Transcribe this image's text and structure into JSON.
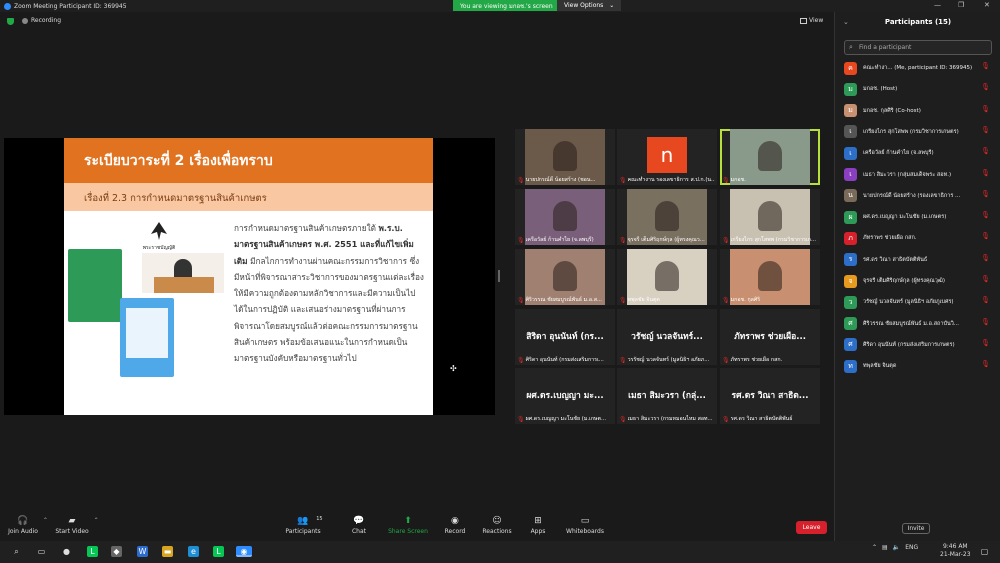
{
  "window": {
    "title": "Zoom Meeting Participant ID: 369945",
    "viewing_banner": "You are viewing มกอช.'s screen",
    "view_options": "View Options"
  },
  "meeting": {
    "recording": "Recording",
    "view": "View"
  },
  "slide": {
    "title": "ระเบียบวาระที่ 2   เรื่องเพื่อทราบ",
    "subtitle": "เรื่องที่ 2.3   การกำหนดมาตรฐานสินค้าเกษตร",
    "body_pre": "การกำหนดมาตรฐานสินค้าเกษตรภายใต้ ",
    "body_bold": "พ.ร.บ. มาตรฐานสินค้าเกษตร พ.ศ. 2551 และที่แก้ไขเพิ่มเติม",
    "body_post": " มีกลไกการทำงานผ่านคณะกรรมการวิชาการ ซึ่งมีหน้าที่พิจารณาสาระวิชาการของมาตรฐานแต่ละเรื่อง ให้มีความถูกต้องตามหลักวิชาการและมีความเป็นไปได้ในการปฏิบัติ และเสนอร่างมาตรฐานที่ผ่านการพิจารณาโดยสมบูรณ์แล้วต่อคณะกรรมการมาตรฐานสินค้าเกษตร พร้อมข้อเสนอแนะในการกำหนดเป็นมาตรฐานบังคับหรือมาตรฐานทั่วไป",
    "emblem_text": "พระราชบัญญัติ"
  },
  "tiles": [
    {
      "name": "นายปกรณ์ดิ์ น้อยสร้าง (ชอน...",
      "big": "",
      "kind": "video",
      "color": "#6b5a4a",
      "highlight": false
    },
    {
      "name": "คณะทำงาน รองเลขาธิการ ส.ป.ก.(น...",
      "big": "",
      "kind": "avatar",
      "avatar": "n",
      "highlight": false
    },
    {
      "name": "มกอช.",
      "big": "",
      "kind": "video",
      "color": "#8a9a8a",
      "highlight": true
    },
    {
      "name": "เครือวัลย์ ก้านคำไย (จ.ลพบุรี)",
      "big": "",
      "kind": "video",
      "color": "#7a5f7a",
      "highlight": false
    },
    {
      "name": "จุรจรี เต็มศิริฤกษ์กุล (ผู้ทรงคุณว...",
      "big": "",
      "kind": "video",
      "color": "#7a7060",
      "highlight": false
    },
    {
      "name": "เกรียงไกร สุกโสพพ (กรมวิชาการเก...",
      "big": "",
      "kind": "video",
      "color": "#c8c0b0",
      "highlight": false
    },
    {
      "name": "ศิริวรรณ ชัยสมบูรณ์พันธ์ ม.อ.ส...",
      "big": "",
      "kind": "video",
      "color": "#a08070",
      "highlight": false
    },
    {
      "name": "ทพุลชัย จินตุด",
      "big": "",
      "kind": "video",
      "color": "#d8d0c0",
      "highlight": false
    },
    {
      "name": "มกอช. กุลศิริ",
      "big": "",
      "kind": "video",
      "color": "#c89070",
      "highlight": false
    },
    {
      "name": "ศิริดา อุนนันท์ (กรมส่งเสริมการเ...",
      "big": "สิริดา อุนนันท์ (กร...",
      "kind": "name",
      "highlight": false
    },
    {
      "name": "วรรัชญ์ นวลจันทร์ (มูลนิธิฯ อภัยภ...",
      "big": "วรัชญ์ นวลจันทร์...",
      "kind": "name",
      "highlight": false
    },
    {
      "name": "ภัทราพร ช่วยเผือ กสก.",
      "big": "ภัทราพร ช่วยเผือ...",
      "kind": "name",
      "highlight": false
    },
    {
      "name": "ผศ.ดร.เบญญา มะโนชัย (ม.เกษต...",
      "big": "ผศ.ดร.เบญญา มะ...",
      "kind": "name",
      "highlight": false
    },
    {
      "name": "เมธา สิมะวรา (กรมหมอนไหม สอท...",
      "big": "เมธา สิมะวรา (กลุ่...",
      "kind": "name",
      "highlight": false
    },
    {
      "name": "รศ.ดร วิณา สาธิตบัตติพันธ์",
      "big": "รศ.ดร วิณา สาธิต...",
      "kind": "name",
      "highlight": false
    }
  ],
  "toolbar": {
    "join_audio": "Join Audio",
    "start_video": "Start Video",
    "participants": "Participants",
    "participants_count": "15",
    "chat": "Chat",
    "share": "Share Screen",
    "record": "Record",
    "reactions": "Reactions",
    "apps": "Apps",
    "whiteboards": "Whiteboards",
    "leave": "Leave"
  },
  "panel": {
    "title": "Participants (15)",
    "search_placeholder": "Find a participant",
    "invite": "Invite",
    "participants": [
      {
        "name": "คณะทำงา... (Me, participant ID: 369945)",
        "initial": "ค",
        "color": "#e8481f"
      },
      {
        "name": "มกอช. (Host)",
        "initial": "ม",
        "color": "#2e9a57"
      },
      {
        "name": "มกอช. กุลศิริ (Co-host)",
        "initial": "ม",
        "color": "#c89070"
      },
      {
        "name": "เกรียงไกร สุกโสพพ (กรมวิชาการเกษตร)",
        "initial": "เ",
        "color": "#555"
      },
      {
        "name": "เครือวัลย์ ก้านคำไย (จ.ลพบุรี)",
        "initial": "เ",
        "color": "#2d6fc8"
      },
      {
        "name": "เมธา สิมะวรา (กลุ่มสมเด็จพระ สอท.)",
        "initial": "เ",
        "color": "#8a3fc0"
      },
      {
        "name": "นายปกรณ์ดิ์ น้อยสร้าง (รองเลขาธิการ ...",
        "initial": "น",
        "color": "#7a6a5a"
      },
      {
        "name": "ผศ.ดร.เบญญา มะโนชัย (ม.เกษตร)",
        "initial": "ผ",
        "color": "#2e9a57"
      },
      {
        "name": "ภัทราพร ช่วยเผือ กสก.",
        "initial": "ภ",
        "color": "#d6202b"
      },
      {
        "name": "รศ.ดร วิณา สาธิตบัตติพันธ์",
        "initial": "ร",
        "color": "#2d6fc8"
      },
      {
        "name": "จุรจรี เต็มศิริฤกษ์กุล (ผู้ทรงคุณวุฒิ)",
        "initial": "จ",
        "color": "#e89a1f"
      },
      {
        "name": "วรัชญ์ นวลจันทร์ (มูลนิธิฯ อภัยภูเบศร)",
        "initial": "ว",
        "color": "#2e9a57"
      },
      {
        "name": "ศิริวรรณ ชัยสมบูรณ์พันธ์ ม.อ.สถาบันวิ...",
        "initial": "ศ",
        "color": "#2e9a57"
      },
      {
        "name": "ศิริดา อุนนันท์ (กรมส่งเสริมการเกษตร)",
        "initial": "ศ",
        "color": "#2d6fc8"
      },
      {
        "name": "ทพุลชัย จินตุด",
        "initial": "ท",
        "color": "#2d6fc8"
      }
    ]
  },
  "taskbar": {
    "lang": "ENG",
    "time": "9:46 AM",
    "date": "21-Mar-23"
  }
}
